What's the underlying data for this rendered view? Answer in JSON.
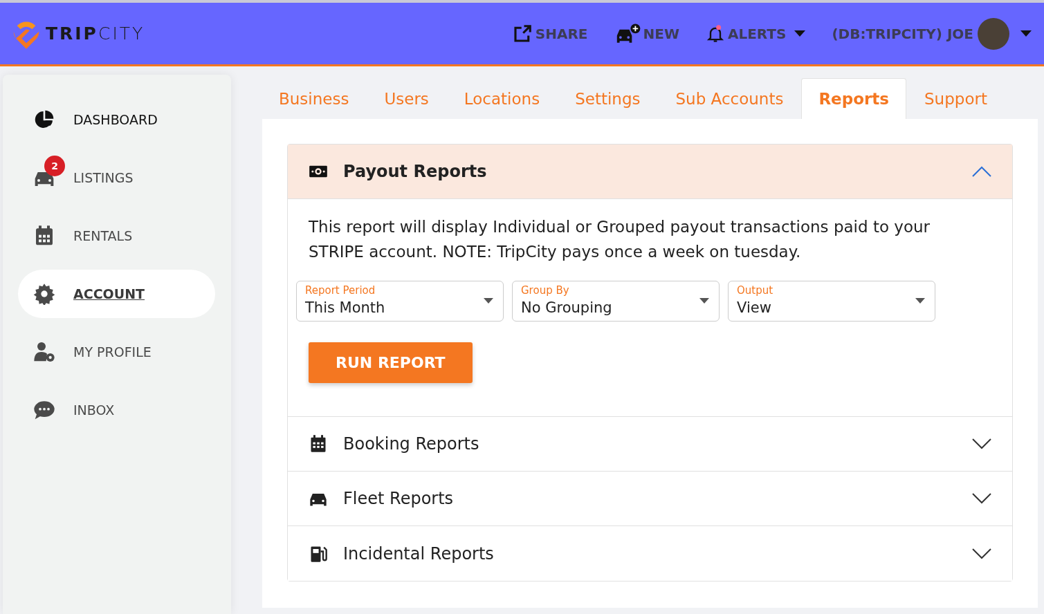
{
  "header": {
    "logo": "**TRIP**CITY",
    "actions": [
      {
        "kind": "share",
        "label": "SHARE"
      },
      {
        "kind": "new",
        "label": "NEW"
      },
      {
        "kind": "alerts",
        "label": "ALERTS",
        "unread": true
      },
      {
        "kind": "user",
        "label": "(DB:TRIPCITY) JOE"
      }
    ]
  },
  "sidebar": {
    "items": [
      {
        "label": "DASHBOARD",
        "selected": false
      },
      {
        "label": "LISTINGS",
        "selected": false,
        "badge": "2"
      },
      {
        "label": "RENTALS",
        "selected": false
      },
      {
        "label": "ACCOUNT",
        "selected": true
      },
      {
        "label": "MY PROFILE",
        "selected": false
      },
      {
        "label": "INBOX",
        "selected": false
      }
    ]
  },
  "tabs": [
    {
      "label": "Business",
      "selected": false
    },
    {
      "label": "Users",
      "selected": false
    },
    {
      "label": "Locations",
      "selected": false
    },
    {
      "label": "Settings",
      "selected": false
    },
    {
      "label": "Sub Accounts",
      "selected": false
    },
    {
      "label": "Reports",
      "selected": true
    },
    {
      "label": "Support",
      "selected": false
    }
  ],
  "sections": [
    {
      "title": "Payout Reports",
      "expanded": true,
      "description": "This report will display Individual or Grouped payout transactions paid to your STRIPE account. NOTE: TripCity pays once a week on tuesday.",
      "fields": [
        {
          "label": "Report Period",
          "value": "This Month"
        },
        {
          "label": "Group By",
          "value": "No Grouping"
        },
        {
          "label": "Output",
          "value": "View"
        }
      ],
      "button": "RUN REPORT"
    },
    {
      "title": "Booking Reports",
      "expanded": false
    },
    {
      "title": "Fleet Reports",
      "expanded": false
    },
    {
      "title": "Incidental Reports",
      "expanded": false
    }
  ]
}
